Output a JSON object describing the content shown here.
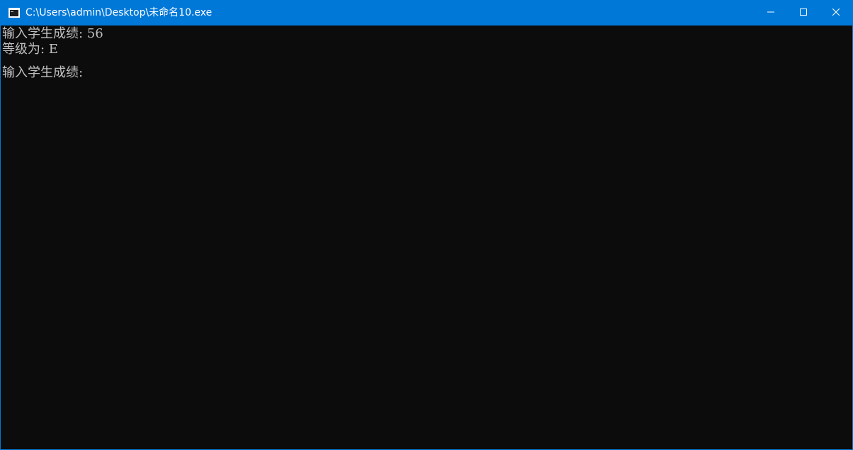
{
  "window": {
    "title": "C:\\Users\\admin\\Desktop\\未命名10.exe",
    "icons": {
      "app": "console-app-icon",
      "minimize": "minimize-icon",
      "maximize": "maximize-icon",
      "close": "close-icon"
    },
    "colors": {
      "titlebar": "#0078d7",
      "console_bg": "#0c0c0c",
      "console_text": "#c0c0c0"
    }
  },
  "console": {
    "lines": [
      "输入学生成绩: 56",
      "等级为: E",
      "",
      "输入学生成绩: "
    ]
  }
}
